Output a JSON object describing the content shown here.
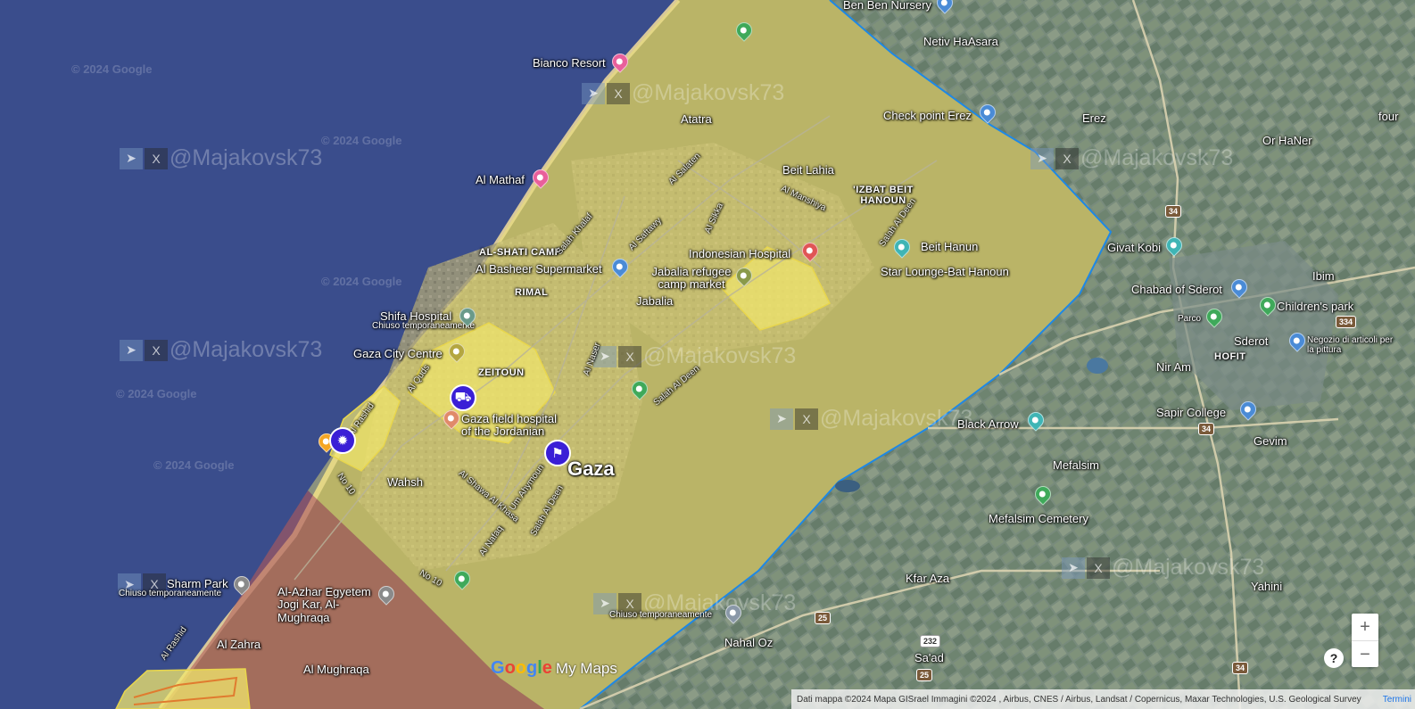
{
  "map": {
    "colors": {
      "sea": "#3a4d8c",
      "land": "#8a8f68",
      "israel": "#6d8590",
      "zone_fill": "#f2e76c",
      "border": "#1e88e5",
      "south_zone": "#b25a58"
    },
    "watermark": "@Majakovsk73",
    "copyright": "© 2024 Google",
    "places": [
      {
        "id": "bianco-resort",
        "text": "Bianco Resort"
      },
      {
        "id": "al-mathaf",
        "text": "Al Mathaf"
      },
      {
        "id": "atatra",
        "text": "Atatra"
      },
      {
        "id": "beit-lahia",
        "text": "Beit Lahia"
      },
      {
        "id": "izbat",
        "text": "'IZBAT BEIT HANOUN"
      },
      {
        "id": "check-erez",
        "text": "Check point Erez"
      },
      {
        "id": "erez",
        "text": "Erez"
      },
      {
        "id": "or-haner",
        "text": "Or HaNer"
      },
      {
        "id": "netiv",
        "text": "Netiv HaAsara"
      },
      {
        "id": "ben-ben",
        "text": "Ben Ben Nursery"
      },
      {
        "id": "shati",
        "text": "AL-SHATI CAMP"
      },
      {
        "id": "basheer",
        "text": "Al Basheer Supermarket"
      },
      {
        "id": "rimal",
        "text": "RIMAL"
      },
      {
        "id": "indonesian",
        "text": "Indonesian Hospital"
      },
      {
        "id": "jabalia-camp",
        "text": "Jabalia refugee camp market"
      },
      {
        "id": "jabalia",
        "text": "Jabalia"
      },
      {
        "id": "beit-hanun",
        "text": "Beit Hanun"
      },
      {
        "id": "star-lounge",
        "text": "Star Lounge-Bat Hanoun"
      },
      {
        "id": "givat-kobi",
        "text": "Givat Kobi"
      },
      {
        "id": "chabad",
        "text": "Chabad of Sderot"
      },
      {
        "id": "ibim",
        "text": "Ibim"
      },
      {
        "id": "childrens-park",
        "text": "Children's park"
      },
      {
        "id": "parco",
        "text": "Parco"
      },
      {
        "id": "sderot",
        "text": "Sderot"
      },
      {
        "id": "hofit",
        "text": "HOFIT"
      },
      {
        "id": "negozio",
        "text": "Negozio di articoli per la pittura"
      },
      {
        "id": "nir-am",
        "text": "Nir Am"
      },
      {
        "id": "shifa",
        "text": "Shifa Hospital"
      },
      {
        "id": "shifa-closed",
        "text": "Chiuso temporaneamente"
      },
      {
        "id": "gaza-centre",
        "text": "Gaza City Centre"
      },
      {
        "id": "zeitoun",
        "text": "ZEITOUN"
      },
      {
        "id": "jordanian",
        "text": "Gaza field hospital of the Jordanian"
      },
      {
        "id": "gaza",
        "text": "Gaza"
      },
      {
        "id": "black-arrow",
        "text": "Black Arrow"
      },
      {
        "id": "sapir",
        "text": "Sapir College"
      },
      {
        "id": "gevim",
        "text": "Gevim"
      },
      {
        "id": "mefalsim",
        "text": "Mefalsim"
      },
      {
        "id": "mefalsim-cem",
        "text": "Mefalsim Cemetery"
      },
      {
        "id": "wahsh",
        "text": "Wahsh"
      },
      {
        "id": "sharm",
        "text": "Sharm Park"
      },
      {
        "id": "sharm-closed",
        "text": "Chiuso temporaneamente"
      },
      {
        "id": "azhar",
        "text": "Al-Azhar Egyetem Jogi Kar, Al-Mughraqa"
      },
      {
        "id": "al-zahra",
        "text": "Al Zahra"
      },
      {
        "id": "al-mughraqa",
        "text": "Al Mughraqa"
      },
      {
        "id": "kfar-aza",
        "text": "Kfar Aza"
      },
      {
        "id": "nahal-oz",
        "text": "Nahal Oz"
      },
      {
        "id": "saad",
        "text": "Sa'ad"
      },
      {
        "id": "yahini",
        "text": "Yahini"
      },
      {
        "id": "chiuso-3",
        "text": "Chiuso temporaneamente"
      },
      {
        "id": "four",
        "text": "four"
      }
    ],
    "roads": [
      {
        "id": "r1",
        "text": "Al Salaten"
      },
      {
        "id": "r2",
        "text": "Al Manshiya"
      },
      {
        "id": "r3",
        "text": "Salah Al Deen"
      },
      {
        "id": "r4",
        "text": "Al Sikka"
      },
      {
        "id": "r5",
        "text": "Al Saftawy"
      },
      {
        "id": "r6",
        "text": "Salah Khalaf"
      },
      {
        "id": "r7",
        "text": "Al Naser"
      },
      {
        "id": "r8",
        "text": "Salah Al Deen"
      },
      {
        "id": "r9",
        "text": "Al Rashid"
      },
      {
        "id": "r10",
        "text": "No 10"
      },
      {
        "id": "r11",
        "text": "Al Shawa Al Khasa"
      },
      {
        "id": "r12",
        "text": "Um Ahymoun"
      },
      {
        "id": "r13",
        "text": "Salah Al Deen"
      },
      {
        "id": "r14",
        "text": "No 10"
      },
      {
        "id": "r15",
        "text": "Al Rashid"
      },
      {
        "id": "r16",
        "text": "Al Quds"
      },
      {
        "id": "r17",
        "text": "Al Nafaq"
      }
    ],
    "shields": [
      "34",
      "34",
      "334",
      "34",
      "232",
      "25",
      "25",
      "34"
    ],
    "zoom": {
      "in": "+",
      "out": "−"
    },
    "help": "?",
    "logo": {
      "brand": "Google",
      "product": "My Maps"
    },
    "attribution": "Dati mappa ©2024 Mapa GISrael Immagini ©2024 , Airbus, CNES / Airbus, Landsat / Copernicus, Maxar Technologies, U.S. Geological Survey",
    "terms": "Termini"
  }
}
